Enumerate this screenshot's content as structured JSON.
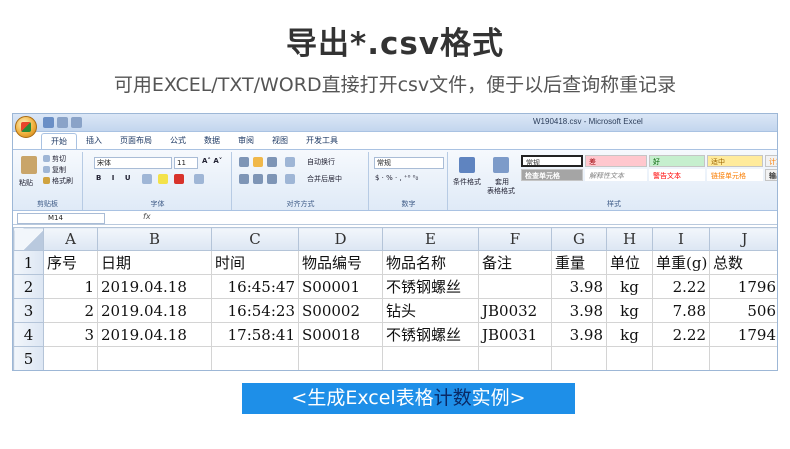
{
  "header": {
    "title": "导出*.csv格式",
    "subtitle": "可用EXCEL/TXT/WORD直接打开csv文件，便于以后查询称重记录"
  },
  "excel": {
    "window_title": "W190418.csv - Microsoft Excel",
    "tabs": [
      "开始",
      "插入",
      "页面布局",
      "公式",
      "数据",
      "审阅",
      "视图",
      "开发工具"
    ],
    "clipboard": {
      "paste": "粘贴",
      "cut": "剪切",
      "copy": "复制",
      "format_painter": "格式刷",
      "group": "剪贴板"
    },
    "font": {
      "name": "宋体",
      "size": "11",
      "group": "字体"
    },
    "alignment": {
      "wrap": "自动换行",
      "merge": "合并后居中",
      "group": "对齐方式"
    },
    "number": {
      "format": "常规",
      "group": "数字"
    },
    "styles": {
      "conditional": "条件格式",
      "table_format": "套用",
      "table_format2": "表格格式",
      "cells": [
        "常规",
        "差",
        "好",
        "适中",
        "计算",
        "检查单元格",
        "解释性文本",
        "警告文本",
        "链接单元格",
        "输出"
      ],
      "group": "样式"
    },
    "name_box": "M14",
    "fx": "fx",
    "columns": [
      "A",
      "B",
      "C",
      "D",
      "E",
      "F",
      "G",
      "H",
      "I",
      "J"
    ],
    "rows": [
      {
        "n": "1",
        "cells": [
          "序号",
          "日期",
          "时间",
          "物品编号",
          "物品名称",
          "备注",
          "重量",
          "单位",
          "单重(g)",
          "总数"
        ]
      },
      {
        "n": "2",
        "cells": [
          "1",
          "2019.04.18",
          "16:45:47",
          "S00001",
          "不锈钢螺丝",
          "",
          "3.98",
          "kg",
          "2.22",
          "1796"
        ]
      },
      {
        "n": "3",
        "cells": [
          "2",
          "2019.04.18",
          "16:54:23",
          "S00002",
          "钻头",
          "JB0032",
          "3.98",
          "kg",
          "7.88",
          "506"
        ]
      },
      {
        "n": "4",
        "cells": [
          "3",
          "2019.04.18",
          "17:58:41",
          "S00018",
          "不锈钢螺丝",
          "JB0031",
          "3.98",
          "kg",
          "2.22",
          "1794"
        ]
      },
      {
        "n": "5",
        "cells": [
          "",
          "",
          "",
          "",
          "",
          "",
          "",
          "",
          "",
          ""
        ]
      }
    ]
  },
  "banner": {
    "left": "<生成Excel表格",
    "mid": "计数",
    "right": "实例>"
  },
  "colors": {
    "banner": "#1e8fe8",
    "ribbon": "#dfeaf7",
    "header_text": "#333333"
  }
}
